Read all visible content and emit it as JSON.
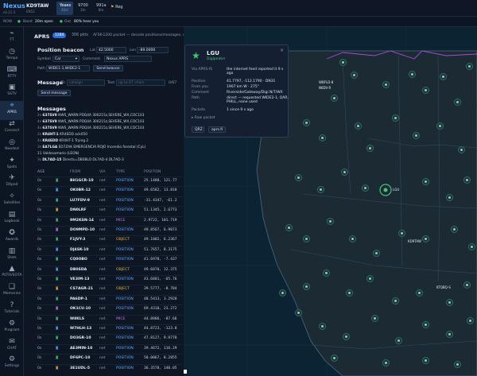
{
  "app": {
    "name": "Nexus",
    "version": "v0.21.3",
    "callsign": "KD9TAW",
    "grid": "EN52"
  },
  "top_chips": [
    {
      "label": "Yeaes",
      "sub": "30m"
    },
    {
      "label": "9700",
      "sub": "2m"
    },
    {
      "label": "991a",
      "sub": "6m"
    }
  ],
  "flag_label": "Reg",
  "status": {
    "now": "NOW",
    "band_label": "Band",
    "band_value": "20m open",
    "out_label": "Out",
    "out_value": "80% hear you"
  },
  "aprs": {
    "title": "APRS",
    "count_badge": "1284",
    "count_text": "306 pkts",
    "description": "AFSK-1200 packet — decode positions/messages, send a beacon",
    "freq_select": "144.390 - N. America",
    "retune": "Re-tune",
    "tune_readout": "14.074 MHz · 20m · USB",
    "tx_off": "TX Off",
    "monitoring": "Monitoring (auto)",
    "no_radio": "No 2 m radio"
  },
  "beacon": {
    "title": "Position beacon",
    "lat_label": "Lat",
    "lat_value": "42.5000",
    "lon_label": "Lon",
    "lon_value": "-89.0000",
    "symbol_label": "Symbol",
    "symbol_value": "Car",
    "comment_label": "Comment",
    "comment_value": "Nexus APRS",
    "path_label": "Path",
    "path_value": "WIDE1-1,WIDE2-1",
    "send_label": "Send beacon"
  },
  "message": {
    "title": "Message",
    "to_label": "To",
    "to_placeholder": "callsign",
    "text_label": "Text",
    "text_placeholder": "up to 67 chars",
    "count": "0/67",
    "send_label": "Send message"
  },
  "messages": {
    "title": "Messages",
    "items": [
      {
        "t": "2s",
        "from": "637SV9",
        "to": "NWS_WARN",
        "body": "PDQ4A 300215z,SEVERE_WX,COC103"
      },
      {
        "t": "4s",
        "from": "637SV9",
        "to": "NWS_WARN",
        "body": "PDQ4A 300215z,SEVERE_WX,COC103"
      },
      {
        "t": "4s",
        "from": "637SV9",
        "to": "NWS_WARN",
        "body": "PDQ4A 300215z,SEVERE_WX,COC103"
      },
      {
        "t": "2s",
        "from": "KR4HT-1",
        "to": "KR4EDD",
        "body": "ack050"
      },
      {
        "t": "4s",
        "from": "KR4EDD",
        "to": "KR4HT-1",
        "body": "Trying 2"
      },
      {
        "t": "3s",
        "from": "EA7LGA",
        "to": "ED7ZAK",
        "body": "EMERGENCIA ROJO Incendio forestal (CyL)"
      },
      {
        "t": "",
        "from": "",
        "to": "",
        "body": "11 Valdesamario (LEON)"
      },
      {
        "t": "3s",
        "from": "DL7AD-15",
        "to": "",
        "body": "Directs=DB0BLO DL7AD-4 DL7AD-3"
      }
    ]
  },
  "table": {
    "headers": {
      "age": "AGE",
      "from": "FROM",
      "via": "VIA",
      "type": "TYPE",
      "pos": "POSITION"
    },
    "rows": [
      {
        "age": "0s",
        "from": "BH1GCR-10",
        "via": "net",
        "type": "POSITION",
        "pos": "25.1488, 121.77"
      },
      {
        "age": "0s",
        "from": "OK0BR-12",
        "via": "net",
        "type": "POSITION",
        "pos": "49.6582, 13.818"
      },
      {
        "age": "0s",
        "from": "LU7FDV-9",
        "via": "net",
        "type": "POSITION",
        "pos": "-31.4347, -61.2"
      },
      {
        "age": "0s",
        "from": "DN0LRF",
        "via": "net",
        "type": "POSITION",
        "pos": "51.1345, 2.6773"
      },
      {
        "age": "0s",
        "from": "9M2KSN-14",
        "via": "net",
        "type": "MICE",
        "pos": "2.9722, 101.719"
      },
      {
        "age": "0s",
        "from": "DO9MPD-10",
        "via": "net",
        "type": "POSITION",
        "pos": "49.8567, 6.9073"
      },
      {
        "age": "0s",
        "from": "F1JVY-3",
        "via": "net",
        "type": "OBJECT",
        "pos": "49.1002, 6.2367"
      },
      {
        "age": "0s",
        "from": "DJ4SK-10",
        "via": "net",
        "type": "POSITION",
        "pos": "51.7657, 8.3175"
      },
      {
        "age": "0s",
        "from": "CQ0OBO",
        "via": "net",
        "type": "POSITION",
        "pos": "41.6978, -7.437"
      },
      {
        "age": "0s",
        "from": "DB0SDA",
        "via": "net",
        "type": "OBJECT",
        "pos": "49.6870, 12.375"
      },
      {
        "age": "0s",
        "from": "VE3IM-13",
        "via": "net",
        "type": "POSITION",
        "pos": "43.6881, -65.76"
      },
      {
        "age": "0s",
        "from": "CS7AGR-21",
        "via": "net",
        "type": "OBJECT",
        "pos": "39.5777, -8.784"
      },
      {
        "age": "0s",
        "from": "PA6DP-1",
        "via": "net",
        "type": "POSITION",
        "pos": "48.5413, 3.2928"
      },
      {
        "age": "0s",
        "from": "OK1CU-10",
        "via": "net",
        "type": "POSITION",
        "pos": "69.4310, 23.272"
      },
      {
        "age": "0s",
        "from": "W8KLS",
        "via": "net",
        "type": "MICE",
        "pos": "44.8886, -87.66"
      },
      {
        "age": "0s",
        "from": "W7HLH-13",
        "via": "net",
        "type": "POSITION",
        "pos": "44.8723, -123.8"
      },
      {
        "age": "0s",
        "from": "DO3GR-10",
        "via": "net",
        "type": "POSITION",
        "pos": "47.8127, 9.9778"
      },
      {
        "age": "0s",
        "from": "AE3MIN-10",
        "via": "net",
        "type": "POSITION",
        "pos": "39.4672, 116.29"
      },
      {
        "age": "0s",
        "from": "DF6PC-10",
        "via": "net",
        "type": "POSITION",
        "pos": "50.0067, 8.2855"
      },
      {
        "age": "0s",
        "from": "3E1UDL-5",
        "via": "net",
        "type": "POSITION",
        "pos": "36.3578, 140.05"
      }
    ]
  },
  "nav": [
    {
      "label": "FT",
      "icon": "ft-icon"
    },
    {
      "label": "Tempo",
      "icon": "tempo-icon"
    },
    {
      "label": "RTTY",
      "icon": "rtty-icon"
    },
    {
      "label": "SSTV",
      "icon": "sstv-icon"
    },
    {
      "label": "APRS",
      "icon": "aprs-icon",
      "active": true
    },
    {
      "label": "Connect",
      "icon": "connect-icon"
    },
    {
      "label": "Needed",
      "icon": "needed-icon"
    },
    {
      "label": "Spots",
      "icon": "spots-icon"
    },
    {
      "label": "DXped",
      "icon": "dxped-icon"
    },
    {
      "label": "Satellites",
      "icon": "satellites-icon"
    },
    {
      "label": "Logbook",
      "icon": "logbook-icon"
    },
    {
      "label": "Awards",
      "icon": "awards-icon"
    },
    {
      "label": "Stats",
      "icon": "stats-icon"
    },
    {
      "label": "POTA/SOTA",
      "icon": "pota-icon"
    },
    {
      "label": "Memories",
      "icon": "memories-icon"
    },
    {
      "label": "Tutorials",
      "icon": "tutorials-icon"
    },
    {
      "label": "Program",
      "icon": "program-icon"
    },
    {
      "label": "CHAT",
      "icon": "chat-icon"
    },
    {
      "label": "Settings",
      "icon": "settings-icon"
    }
  ],
  "popup": {
    "call": "LGU",
    "sym": "Digipeater",
    "via_label": "Via APRS-IS",
    "via_value": "the internet feed reported it 9 s ago",
    "pos_label": "Position",
    "pos_value": "41.7797, -112.1790 · DN31",
    "from_label": "From you",
    "from_value": "1907 km W · 275°",
    "comment_label": "Comment",
    "comment_value": "Riverside/Gateway/Digi N/T/WX",
    "path_label": "Path",
    "path_value": "direct — requested WIDE2-1, QAR, PHILL, none used",
    "packets_label": "Packets",
    "packets_value": "1 since 9 s ago",
    "raw_label": "▸ Raw packet",
    "btn_qrz": "QRZ",
    "btn_aprsfi": "aprs.fi"
  },
  "map_labels": [
    "WBFLD-8",
    "N6DV-R",
    "LGU",
    "KTQBQ-S",
    "KD9TAW"
  ],
  "colors": {
    "accent": "#5aa9ff",
    "badge": "#2e6fd6",
    "monitor": "#1e6fd9",
    "green": "#47c27a"
  }
}
